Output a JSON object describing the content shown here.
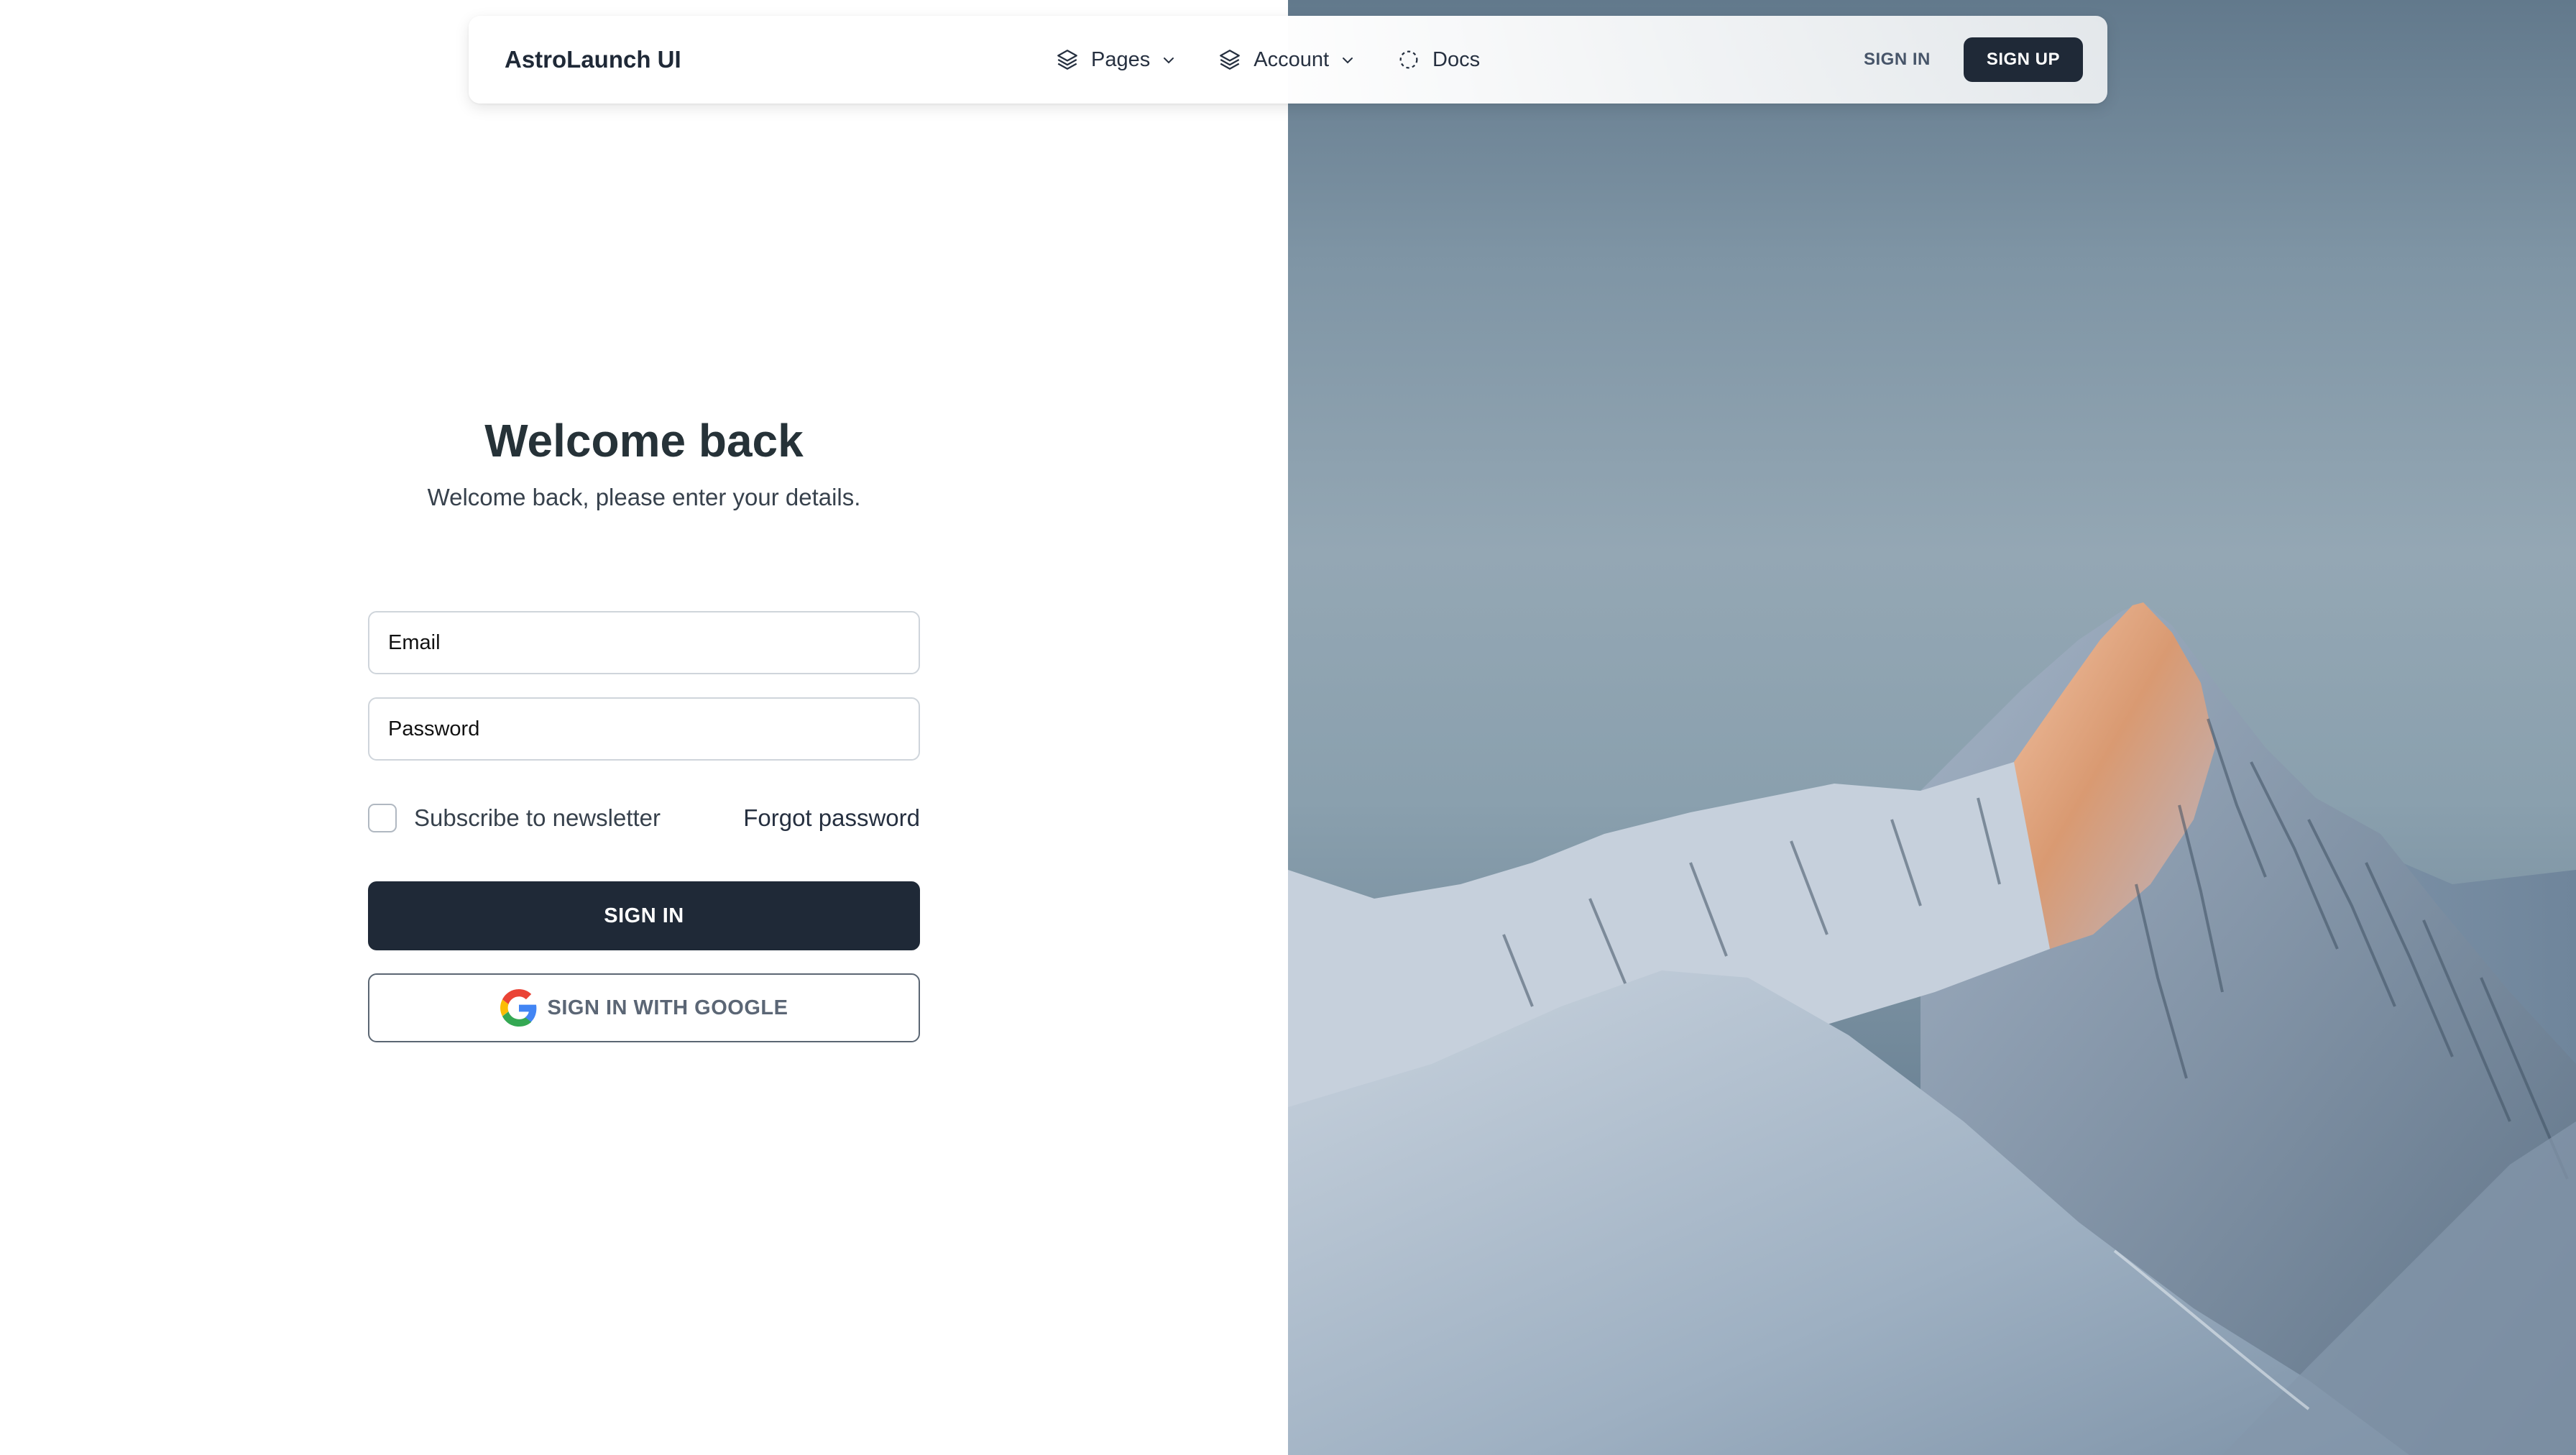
{
  "navbar": {
    "brand": "AstroLaunch UI",
    "links": [
      {
        "label": "Pages",
        "icon": "layers-icon",
        "has_dropdown": true
      },
      {
        "label": "Account",
        "icon": "layers-icon",
        "has_dropdown": true
      },
      {
        "label": "Docs",
        "icon": "dashed-circle-icon",
        "has_dropdown": false
      }
    ],
    "sign_in_label": "SIGN IN",
    "sign_up_label": "SIGN UP"
  },
  "login": {
    "title": "Welcome back",
    "subtitle": "Welcome back, please enter your details.",
    "email_placeholder": "Email",
    "password_placeholder": "Password",
    "newsletter_label": "Subscribe to newsletter",
    "newsletter_checked": false,
    "forgot_label": "Forgot password",
    "submit_label": "SIGN IN",
    "google_label": "SIGN IN WITH GOOGLE"
  },
  "colors": {
    "primary": "#1f2937",
    "text": "#263238",
    "muted": "#37414c",
    "border": "#cfd5db"
  },
  "hero": {
    "image": "snowy-mountain-peak"
  }
}
